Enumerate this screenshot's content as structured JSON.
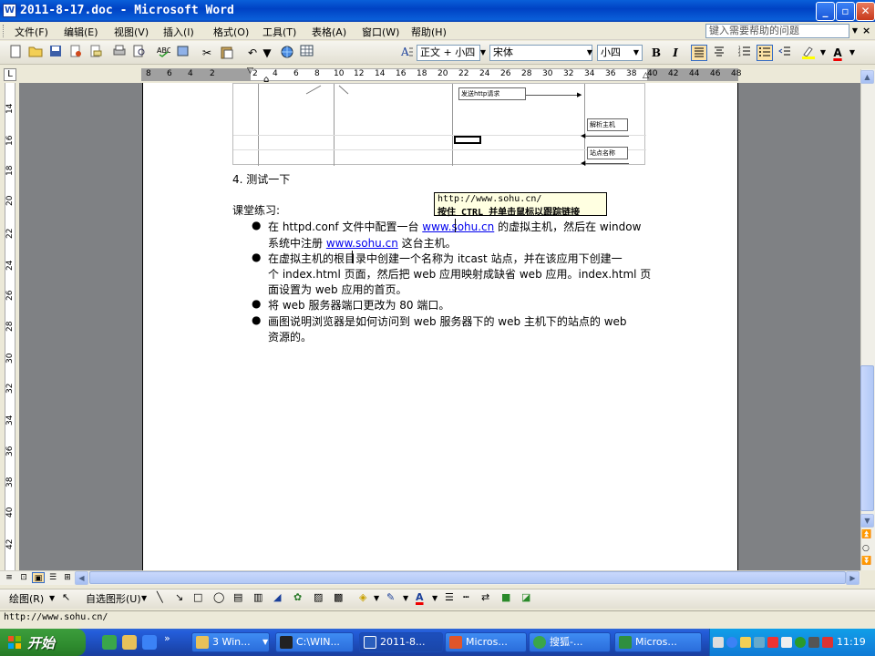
{
  "window": {
    "title": "2011-8-17.doc - Microsoft Word",
    "minimize": "_",
    "maximize": "▫",
    "close": "✕"
  },
  "menu": {
    "items": [
      "文件(F)",
      "编辑(E)",
      "视图(V)",
      "插入(I)",
      "格式(O)",
      "工具(T)",
      "表格(A)",
      "窗口(W)",
      "帮助(H)"
    ],
    "help_placeholder": "键入需要帮助的问题"
  },
  "toolbar": {
    "style_value": "正文 + 小四",
    "font_value": "宋体",
    "size_value": "小四",
    "bold_label": "B",
    "italic_label": "I",
    "font_color_label": "A"
  },
  "ruler": {
    "labels": [
      "8",
      "6",
      "4",
      "2",
      "2",
      "4",
      "6",
      "8",
      "10",
      "12",
      "14",
      "16",
      "18",
      "20",
      "22",
      "24",
      "26",
      "28",
      "30",
      "32",
      "34",
      "36",
      "38",
      "40",
      "42",
      "44",
      "46",
      "48"
    ],
    "vertical_labels": [
      "14",
      "16",
      "18",
      "20",
      "22",
      "24",
      "26",
      "28",
      "30",
      "32",
      "34",
      "36",
      "38",
      "40",
      "42"
    ],
    "tab_selector": "L"
  },
  "diagram": {
    "box_send_request": "发送http请求",
    "box_resolve_host": "解析主机",
    "box_site_name": "站点名称"
  },
  "document": {
    "heading4": "4.  测试一下",
    "exercise_label": "课堂练习:",
    "bullet_char": "●",
    "b1_l1_a": "在 httpd.conf 文件中配置一台 ",
    "b1_l1_link": "www.sohu.cn",
    "b1_l1_b": " 的虚拟主机，然后在 window",
    "b1_l2_a": "系统中注册 ",
    "b1_l2_link": "www.sohu.cn",
    "b1_l2_b": " 这台主机。",
    "b2_l1": "在虚拟主机的根目录中创建一个名称为 itcast 站点，并在该应用下创建一",
    "b2_l2": "个 index.html 页面，然后把 web 应用映射成缺省 web 应用。index.html 页",
    "b2_l3": "面设置为 web 应用的首页。",
    "b3": "将 web 服务器端口更改为 80 端口。",
    "b4_l1": "画图说明浏览器是如何访问到 web 服务器下的 web 主机下的站点的 web",
    "b4_l2": "资源的。"
  },
  "tooltip": {
    "url": "http://www.sohu.cn/",
    "hint": "按住 CTRL 并单击鼠标以跟踪链接"
  },
  "drawbar": {
    "draw_label": "绘图(R)",
    "autoshapes_label": "自选图形(U)"
  },
  "status": {
    "text": "http://www.sohu.cn/"
  },
  "taskbar": {
    "start_label": "开始",
    "buttons": [
      {
        "label": "3 Win...",
        "color": "#e8c15a"
      },
      {
        "label": "C:\\WIN...",
        "color": "#222222"
      },
      {
        "label": "2011-8...",
        "color": "#2b5fbd"
      },
      {
        "label": "Micros...",
        "color": "#e0552a"
      },
      {
        "label": "搜狐-...",
        "color": "#3aa64a"
      },
      {
        "label": "Micros...",
        "color": "#2f8f3f"
      }
    ],
    "clock": "11:19"
  },
  "colors": {
    "title_bar": "#0a5fd9",
    "link": "#0000ee",
    "tooltip_bg": "#ffffe1",
    "start_green": "#2f8c2f"
  }
}
